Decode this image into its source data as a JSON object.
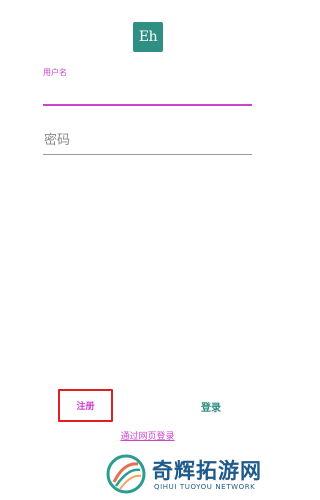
{
  "app": {
    "logo_text": "Eh"
  },
  "form": {
    "username_label": "用户名",
    "username_value": "",
    "password_placeholder": "密码",
    "password_value": ""
  },
  "actions": {
    "register_label": "注册",
    "login_label": "登录",
    "web_login_label": "通过网页登录"
  },
  "watermark": {
    "title": "奇辉拓游网",
    "subtitle": "QIHUI TUOYOU NETWORK"
  },
  "colors": {
    "accent": "#cc44cc",
    "primary": "#2f8f83",
    "highlight_box": "#e02020",
    "watermark": "#1e5a8a"
  }
}
